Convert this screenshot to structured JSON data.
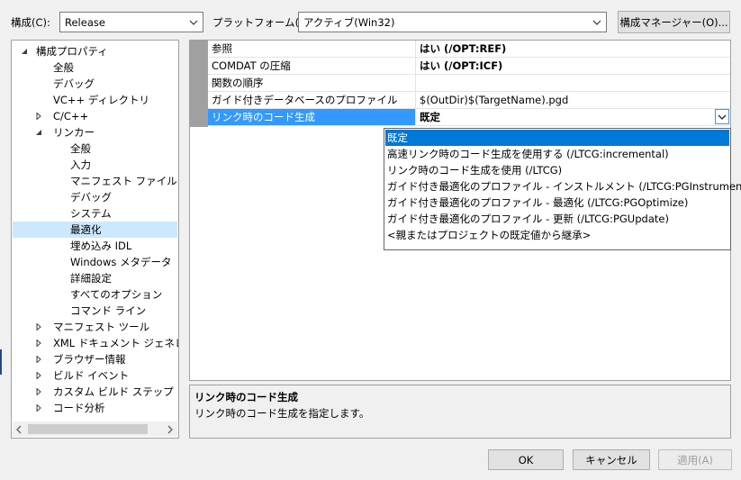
{
  "header": {
    "config_label": "構成(C):",
    "config_value": "Release",
    "platform_label": "プラットフォーム(P):",
    "platform_value": "アクティブ(Win32)",
    "config_manager_button": "構成マネージャー(O)..."
  },
  "tree": {
    "items": [
      {
        "label": "構成プロパティ",
        "expander": "expanded"
      },
      {
        "label": "全般",
        "expander": "none"
      },
      {
        "label": "デバッグ",
        "expander": "none"
      },
      {
        "label": "VC++ ディレクトリ",
        "expander": "none"
      },
      {
        "label": "C/C++",
        "expander": "collapsed"
      },
      {
        "label": "リンカー",
        "expander": "expanded"
      },
      {
        "label": "全般",
        "expander": "none"
      },
      {
        "label": "入力",
        "expander": "none"
      },
      {
        "label": "マニフェスト ファイル",
        "expander": "none"
      },
      {
        "label": "デバッグ",
        "expander": "none"
      },
      {
        "label": "システム",
        "expander": "none"
      },
      {
        "label": "最適化",
        "expander": "none",
        "selected": true
      },
      {
        "label": "埋め込み IDL",
        "expander": "none"
      },
      {
        "label": "Windows メタデータ",
        "expander": "none"
      },
      {
        "label": "詳細設定",
        "expander": "none"
      },
      {
        "label": "すべてのオプション",
        "expander": "none"
      },
      {
        "label": "コマンド ライン",
        "expander": "none"
      },
      {
        "label": "マニフェスト ツール",
        "expander": "collapsed"
      },
      {
        "label": "XML ドキュメント ジェネレーター",
        "expander": "collapsed"
      },
      {
        "label": "ブラウザー情報",
        "expander": "collapsed"
      },
      {
        "label": "ビルド イベント",
        "expander": "collapsed"
      },
      {
        "label": "カスタム ビルド ステップ",
        "expander": "collapsed"
      },
      {
        "label": "コード分析",
        "expander": "collapsed"
      }
    ]
  },
  "grid": {
    "rows": [
      {
        "name": "参照",
        "value": "はい (/OPT:REF)",
        "bold": true
      },
      {
        "name": "COMDAT の圧縮",
        "value": "はい (/OPT:ICF)",
        "bold": true
      },
      {
        "name": "関数の順序",
        "value": "",
        "bold": false
      },
      {
        "name": "ガイド付きデータベースのプロファイル",
        "value": "$(OutDir)$(TargetName).pgd",
        "bold": false
      },
      {
        "name": "リンク時のコード生成",
        "value": "既定",
        "bold": true,
        "selected": true
      }
    ]
  },
  "dropdown": {
    "options": [
      "既定",
      "高速リンク時のコード生成を使用する (/LTCG:incremental)",
      "リンク時のコード生成を使用 (/LTCG)",
      "ガイド付き最適化のプロファイル - インストルメント (/LTCG:PGInstrument)",
      "ガイド付き最適化のプロファイル - 最適化 (/LTCG:PGOptimize)",
      "ガイド付き最適化のプロファイル - 更新 (/LTCG:PGUpdate)",
      "<親またはプロジェクトの既定値から継承>"
    ],
    "highlighted_index": 0
  },
  "description": {
    "title": "リンク時のコード生成",
    "text": "リンク時のコード生成を指定します。"
  },
  "footer": {
    "ok": "OK",
    "cancel": "キャンセル",
    "apply": "適用(A)"
  },
  "icons": {
    "expanded": "triangle-down-icon",
    "collapsed": "triangle-right-icon",
    "chevron": "chevron-down-icon"
  },
  "colors": {
    "selection_blue": "#3399ff",
    "dropdown_highlight": "#0078d7",
    "tree_selection": "#cce8ff"
  }
}
